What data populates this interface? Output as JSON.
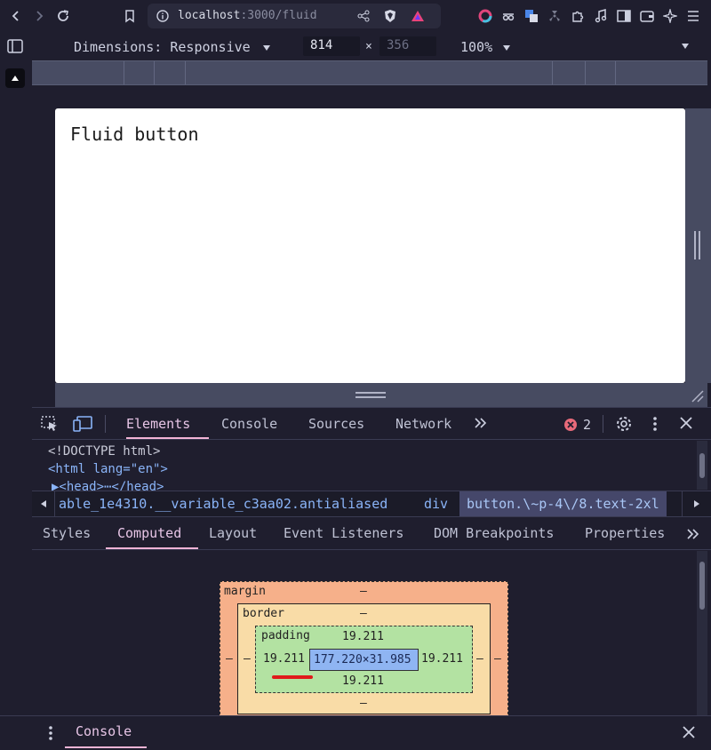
{
  "browser": {
    "url_host": "localhost",
    "url_rest": ":3000/fluid"
  },
  "device_toolbar": {
    "dimensions_label": "Dimensions: Responsive",
    "width": "814",
    "times": "×",
    "height": "356",
    "zoom": "100%"
  },
  "page": {
    "button_text": "Fluid button"
  },
  "devtools": {
    "tabs": [
      "Elements",
      "Console",
      "Sources",
      "Network"
    ],
    "error_count": "2",
    "dom_lines": [
      "<!DOCTYPE html>",
      "<html lang=\"en\">",
      "▶<head>⋯</head>"
    ],
    "breadcrumbs": [
      "able_1e4310.__variable_c3aa02.antialiased",
      "div",
      "button.\\~p-4\\/8.text-2xl"
    ],
    "sub_tabs": [
      "Styles",
      "Computed",
      "Layout",
      "Event Listeners",
      "DOM Breakpoints",
      "Properties"
    ],
    "box_model": {
      "margin_label": "margin",
      "border_label": "border",
      "padding_label": "padding",
      "margin_top": "–",
      "border_top": "–",
      "padding_top": "19.211",
      "padding_left": "19.211",
      "padding_right": "19.211",
      "padding_bottom": "19.211",
      "content": "177.220×31.985",
      "border_left": "–",
      "border_right": "–",
      "margin_left": "–",
      "margin_right": "–",
      "border_bottom": "–"
    }
  },
  "drawer": {
    "tab": "Console"
  },
  "colors": {
    "accent": "#f2b4d6",
    "link": "#8ab4f8",
    "error": "#e86a7a",
    "annotation": "#e01b1b"
  }
}
